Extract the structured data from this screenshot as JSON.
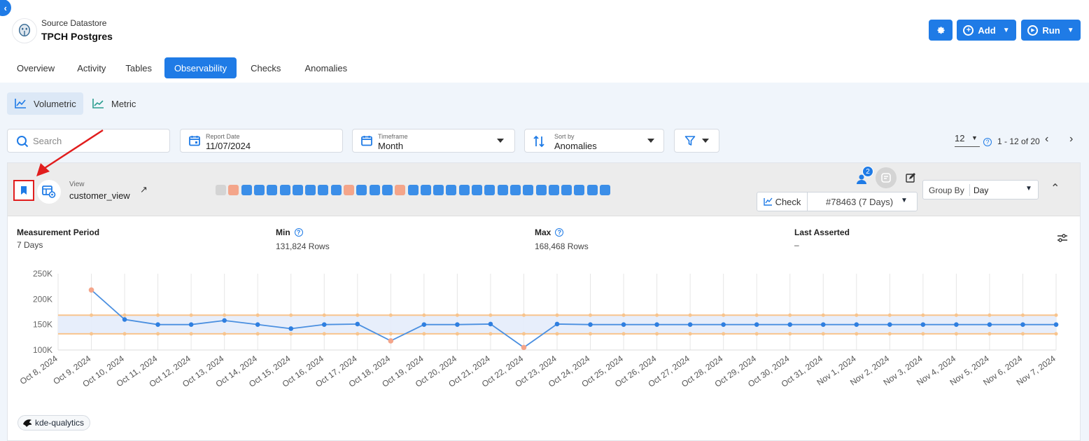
{
  "datastore": {
    "subtitle": "Source Datastore",
    "name": "TPCH Postgres"
  },
  "actions": {
    "add": "Add",
    "run": "Run"
  },
  "tabs": [
    {
      "label": "Overview",
      "active": false
    },
    {
      "label": "Activity",
      "active": false
    },
    {
      "label": "Tables",
      "active": false
    },
    {
      "label": "Observability",
      "active": true
    },
    {
      "label": "Checks",
      "active": false
    },
    {
      "label": "Anomalies",
      "active": false
    }
  ],
  "subtabs": {
    "volumetric": "Volumetric",
    "metric": "Metric"
  },
  "filters": {
    "search_placeholder": "Search",
    "report_date_label": "Report Date",
    "report_date": "11/07/2024",
    "timeframe_label": "Timeframe",
    "timeframe": "Month",
    "sortby_label": "Sort by",
    "sortby": "Anomalies"
  },
  "pager": {
    "page_size": "12",
    "range": "1 - 12 of 20"
  },
  "card": {
    "view_label": "View",
    "view_name": "customer_view",
    "badge_count": "2",
    "check_label": "Check",
    "check_value": "#78463 (7 Days)",
    "group_by_label": "Group By",
    "group_by_value": "Day",
    "status_squares": [
      "empty",
      "anomaly",
      "ok",
      "ok",
      "ok",
      "ok",
      "ok",
      "ok",
      "ok",
      "ok",
      "anomaly",
      "ok",
      "ok",
      "ok",
      "anomaly",
      "ok",
      "ok",
      "ok",
      "ok",
      "ok",
      "ok",
      "ok",
      "ok",
      "ok",
      "ok",
      "ok",
      "ok",
      "ok",
      "ok",
      "ok",
      "ok"
    ]
  },
  "metrics": {
    "measurement_period_label": "Measurement Period",
    "measurement_period": "7 Days",
    "min_label": "Min",
    "min": "131,824 Rows",
    "max_label": "Max",
    "max": "168,468 Rows",
    "last_asserted_label": "Last Asserted",
    "last_asserted": "–"
  },
  "tag": "kde-qualytics",
  "colors": {
    "accent": "#1f7be6",
    "anomaly": "#f4a58a",
    "ok": "#3b8ee8",
    "threshold": "#f8c48d"
  },
  "chart_data": {
    "type": "line",
    "categories": [
      "Oct 8, 2024",
      "Oct 9, 2024",
      "Oct 10, 2024",
      "Oct 11, 2024",
      "Oct 12, 2024",
      "Oct 13, 2024",
      "Oct 14, 2024",
      "Oct 15, 2024",
      "Oct 16, 2024",
      "Oct 17, 2024",
      "Oct 18, 2024",
      "Oct 19, 2024",
      "Oct 20, 2024",
      "Oct 21, 2024",
      "Oct 22, 2024",
      "Oct 23, 2024",
      "Oct 24, 2024",
      "Oct 25, 2024",
      "Oct 26, 2024",
      "Oct 27, 2024",
      "Oct 28, 2024",
      "Oct 29, 2024",
      "Oct 30, 2024",
      "Oct 31, 2024",
      "Nov 1, 2024",
      "Nov 2, 2024",
      "Nov 3, 2024",
      "Nov 4, 2024",
      "Nov 5, 2024",
      "Nov 6, 2024",
      "Nov 7, 2024"
    ],
    "series": [
      {
        "values": [
          null,
          218000,
          160000,
          150000,
          150000,
          158000,
          150000,
          142000,
          150000,
          151000,
          118000,
          150000,
          150000,
          151000,
          105000,
          151000,
          150000,
          150000,
          150000,
          150000,
          150000,
          150000,
          150000,
          150000,
          150000,
          150000,
          150000,
          150000,
          150000,
          150000,
          150000
        ],
        "anomalies": [
          1,
          10,
          14
        ]
      }
    ],
    "upper_threshold": 168468,
    "lower_threshold": 131824,
    "threshold_start_index": 1,
    "yticks": [
      "100K",
      "150K",
      "200K",
      "250K"
    ],
    "ylim": [
      100000,
      250000
    ],
    "grid": true
  }
}
